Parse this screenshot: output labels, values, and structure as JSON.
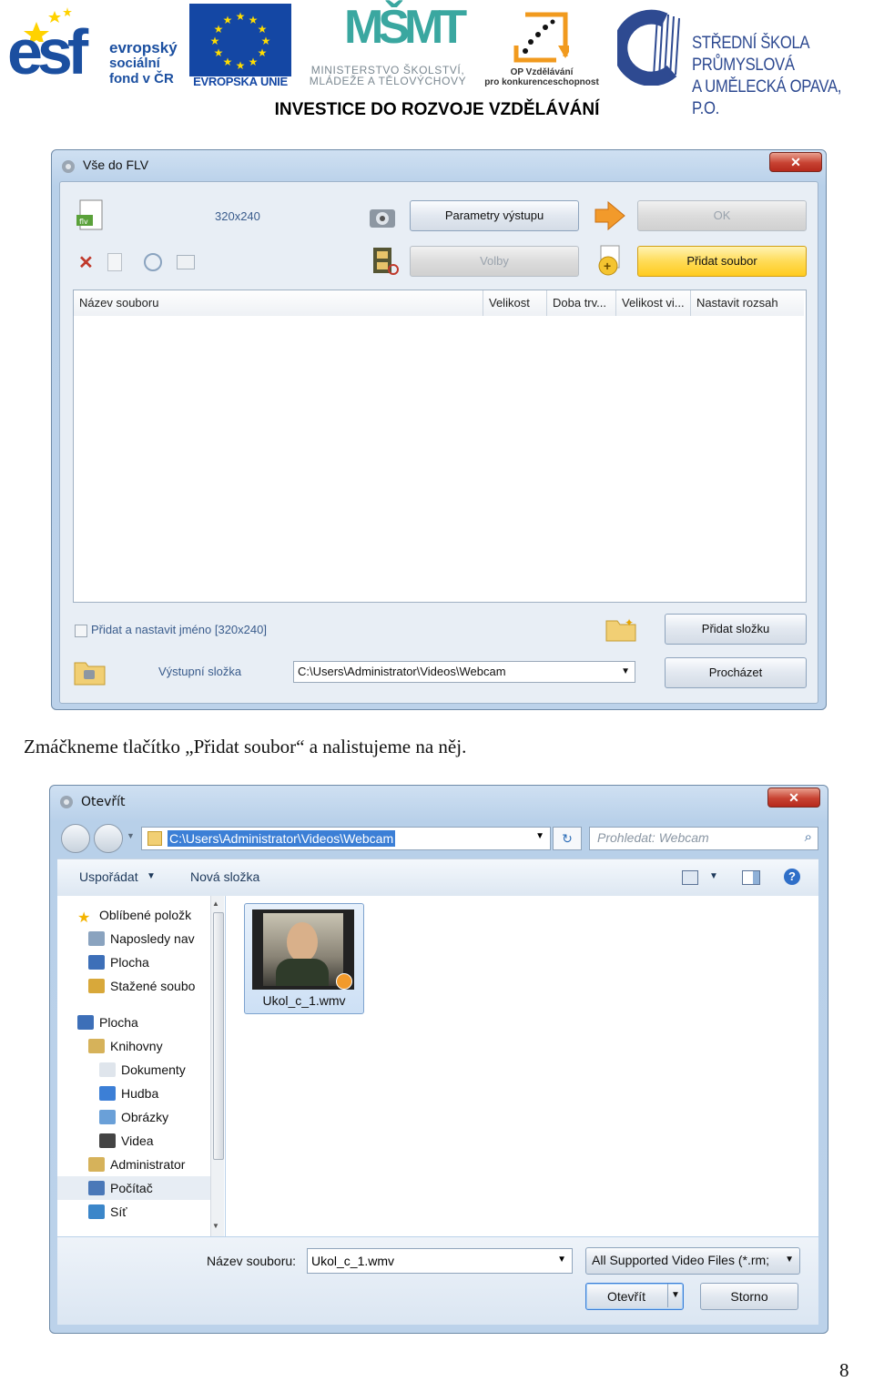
{
  "header": {
    "esf_word": "esf",
    "esf_lines": [
      "evropský",
      "sociální",
      "fond v ČR"
    ],
    "eu_caption": "EVROPSKÁ UNIE",
    "msmt_mark": "MŠMT",
    "msmt_lines": [
      "MINISTERSTVO ŠKOLSTVÍ,",
      "MLÁDEŽE A TĚLOVÝCHOVY"
    ],
    "op_lines": [
      "OP Vzdělávání",
      "pro konkurenceschopnost"
    ],
    "sspu_lines": [
      "STŘEDNÍ ŠKOLA PRŮMYSLOVÁ",
      "A UMĚLECKÁ OPAVA, P.O."
    ],
    "investment": "INVESTICE DO ROZVOJE VZDĚLÁVÁNÍ"
  },
  "flv_window": {
    "title": "Vše do FLV",
    "resolution": "320x240",
    "btn_params": "Parametry výstupu",
    "btn_ok": "OK",
    "btn_options": "Volby",
    "btn_add_file": "Přidat soubor",
    "columns": [
      "Název souboru",
      "Velikost",
      "Doba trv...",
      "Velikost vi...",
      "Nastavit rozsah"
    ],
    "checkbox_label": "Přidat a nastavit jméno [320x240]",
    "btn_add_folder": "Přidat složku",
    "output_label": "Výstupní složka",
    "output_path": "C:\\Users\\Administrator\\Videos\\Webcam",
    "btn_browse": "Procházet"
  },
  "caption": "Zmáčkneme tlačítko „Přidat soubor“ a nalistujeme na něj.",
  "open_dialog": {
    "title": "Otevřít",
    "address": "C:\\Users\\Administrator\\Videos\\Webcam",
    "search_placeholder": "Prohledat: Webcam",
    "organize": "Uspořádat",
    "new_folder": "Nová složka",
    "tree": [
      {
        "label": "Oblíbené položk",
        "indent": 0,
        "icon": "star-icon"
      },
      {
        "label": "Naposledy nav",
        "indent": 1,
        "icon": "recent-places-icon"
      },
      {
        "label": "Plocha",
        "indent": 1,
        "icon": "desktop-icon"
      },
      {
        "label": "Stažené soubo",
        "indent": 1,
        "icon": "downloads-icon"
      },
      {
        "label": "Plocha",
        "indent": 0,
        "icon": "desktop-icon"
      },
      {
        "label": "Knihovny",
        "indent": 1,
        "icon": "libraries-icon"
      },
      {
        "label": "Dokumenty",
        "indent": 2,
        "icon": "documents-icon"
      },
      {
        "label": "Hudba",
        "indent": 2,
        "icon": "music-icon"
      },
      {
        "label": "Obrázky",
        "indent": 2,
        "icon": "pictures-icon"
      },
      {
        "label": "Videa",
        "indent": 2,
        "icon": "videos-icon"
      },
      {
        "label": "Administrator",
        "indent": 1,
        "icon": "user-folder-icon"
      },
      {
        "label": "Počítač",
        "indent": 1,
        "icon": "computer-icon"
      },
      {
        "label": "Síť",
        "indent": 1,
        "icon": "network-icon"
      }
    ],
    "file_name": "Ukol_c_1.wmv",
    "filename_label": "Název souboru:",
    "filename_value": "Ukol_c_1.wmv",
    "filter": "All Supported Video Files (*.rm;",
    "btn_open": "Otevřít",
    "btn_cancel": "Storno"
  },
  "page_number": "8",
  "colors": {
    "esf_blue": "#1b4fa0",
    "eu_blue": "#1447a4",
    "eu_star": "#ffdd00",
    "msmt_teal": "#3aa7a0",
    "op_orange": "#f19a1e",
    "selection_blue": "#3c7fd6"
  }
}
